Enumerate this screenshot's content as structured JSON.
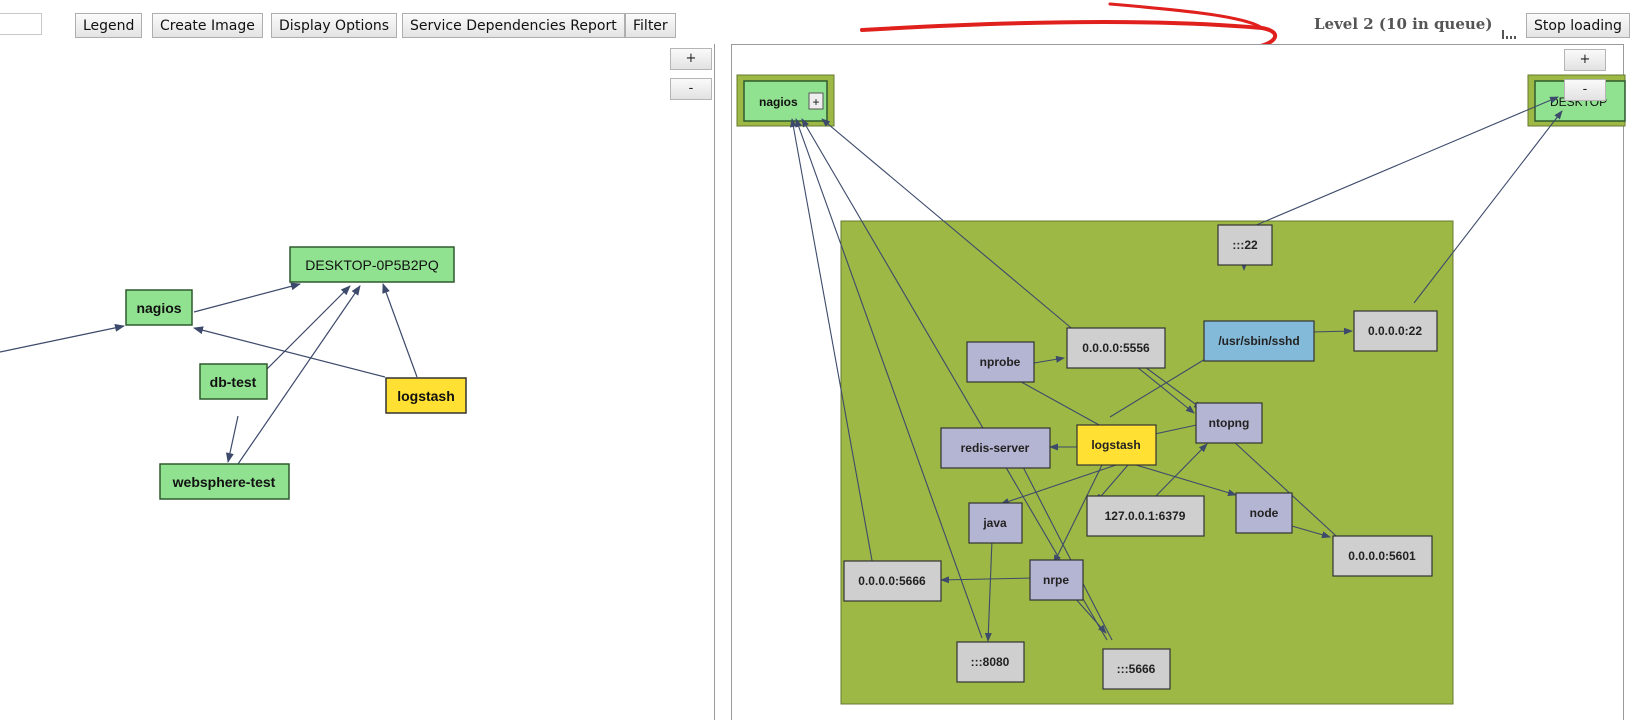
{
  "toolbar": {
    "legend": "Legend",
    "create_image": "Create Image",
    "display_options": "Display Options",
    "service_dependencies_report": "Service Dependencies Report",
    "filter": "Filter",
    "status": "Level 2 (10 in queue)",
    "stop_loading": "Stop loading"
  },
  "zoom": {
    "in": "+",
    "out": "-"
  },
  "left_graph": {
    "nodes": {
      "desktop": "DESKTOP-0P5B2PQ",
      "nagios": "nagios",
      "db_test": "db-test",
      "logstash": "logstash",
      "websphere_test": "websphere-test"
    }
  },
  "right_graph": {
    "nagios": "nagios",
    "nagios_expand": "+",
    "desktop_partial": "DESKTOP",
    "nodes": {
      "p22": ":::22",
      "sshd": "/usr/sbin/sshd",
      "a22": "0.0.0.0:22",
      "nprobe": "nprobe",
      "a5556": "0.0.0.0:5556",
      "redis": "redis-server",
      "logstash": "logstash",
      "ntopng": "ntopng",
      "java": "java",
      "r6379": "127.0.0.1:6379",
      "node": "node",
      "a5601": "0.0.0.0:5601",
      "a5666": "0.0.0.0:5666",
      "nrpe": "nrpe",
      "p8080": ":::8080",
      "p5666": ":::5666"
    }
  },
  "colors": {
    "host_green": "#90e290",
    "logstash_yellow": "#ffe033",
    "process_lavender": "#b4b4d3",
    "port_gray": "#cfcfcf",
    "sshd_blue": "#84bad9",
    "group_olive": "#9db845",
    "edge": "#3d4a6b",
    "annotation_red": "#e0201c"
  }
}
